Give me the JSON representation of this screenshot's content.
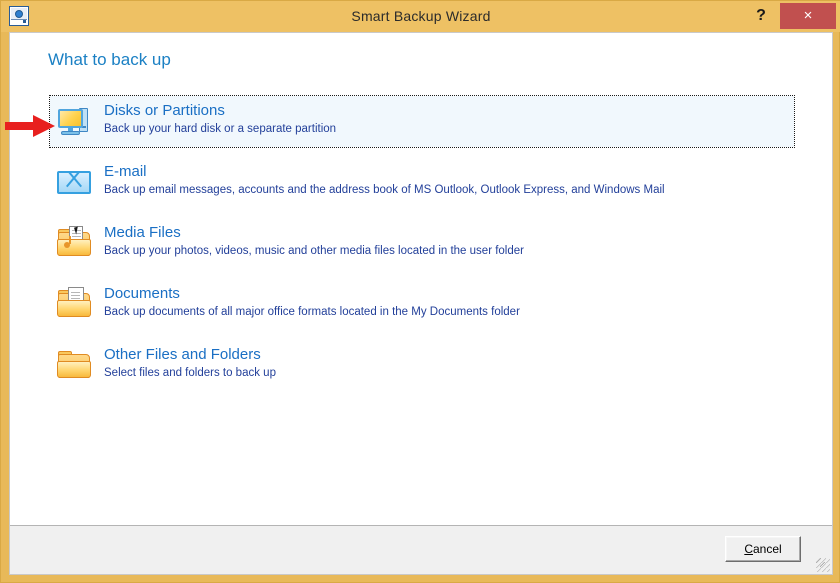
{
  "window": {
    "title": "Smart Backup Wizard",
    "app_icon": "disk-drive-icon",
    "help_label": "?",
    "close_label": "×",
    "titlebar_color": "#eec164",
    "close_color": "#c1504f"
  },
  "page": {
    "heading": "What to back up",
    "heading_color": "#1b80c4"
  },
  "options": [
    {
      "icon": "monitor-icon",
      "title": "Disks or Partitions",
      "description": "Back up your hard disk or a separate partition",
      "focused": true
    },
    {
      "icon": "envelope-icon",
      "title": "E-mail",
      "description": "Back up email messages, accounts and the address book of MS Outlook, Outlook Express, and Windows Mail",
      "focused": false
    },
    {
      "icon": "media-folder-icon",
      "title": "Media Files",
      "description": "Back up your photos, videos, music and other media files located in the user folder",
      "focused": false
    },
    {
      "icon": "documents-folder-icon",
      "title": "Documents",
      "description": "Back up documents of all major office formats located in the My Documents folder",
      "focused": false
    },
    {
      "icon": "folder-icon",
      "title": "Other Files and Folders",
      "description": "Select files and folders to back up",
      "focused": false
    }
  ],
  "footer": {
    "cancel_accel": "C",
    "cancel_rest": "ancel"
  },
  "annotation": {
    "arrow": "red-right-arrow",
    "color": "#e8201f"
  }
}
